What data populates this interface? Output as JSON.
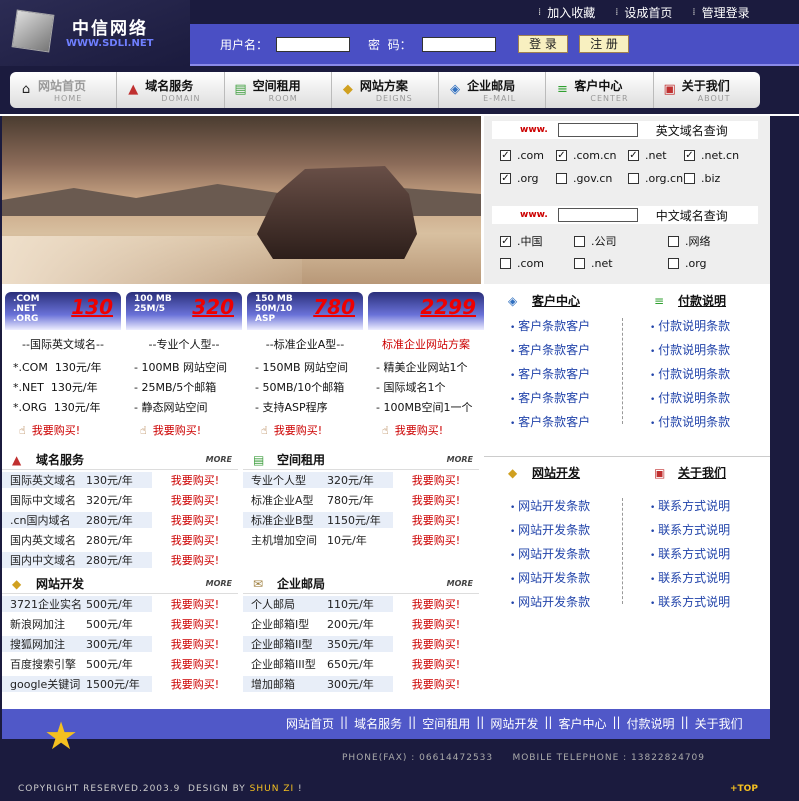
{
  "brand": {
    "name": "中信网络",
    "url": "WWW.SDLI.NET"
  },
  "topbar": [
    "加入收藏",
    "设成首页",
    "管理登录"
  ],
  "login": {
    "user_label": "用户名：",
    "pass_label": "密  码：",
    "login_btn": "登 录",
    "register_btn": "注 册"
  },
  "nav": [
    {
      "cn": "网站首页",
      "en": "HOME",
      "icon": "home-icon"
    },
    {
      "cn": "域名服务",
      "en": "DOMAIN",
      "icon": "domain-icon"
    },
    {
      "cn": "空间租用",
      "en": "ROOM",
      "icon": "room-icon"
    },
    {
      "cn": "网站方案",
      "en": "DEIGNS",
      "icon": "design-icon"
    },
    {
      "cn": "企业邮局",
      "en": "E-MAIL",
      "icon": "email-icon"
    },
    {
      "cn": "客户中心",
      "en": "CENTER",
      "icon": "center-icon"
    },
    {
      "cn": "关于我们",
      "en": "ABOUT",
      "icon": "about-icon"
    }
  ],
  "query_en": {
    "stars": "www.",
    "title": "英文域名查询",
    "row1": [
      {
        "label": ".com",
        "checked": true
      },
      {
        "label": ".com.cn",
        "checked": true
      },
      {
        "label": ".net",
        "checked": true
      },
      {
        "label": ".net.cn",
        "checked": true
      }
    ],
    "row2": [
      {
        "label": ".org",
        "checked": true
      },
      {
        "label": ".gov.cn",
        "checked": false
      },
      {
        "label": ".org.cn",
        "checked": false
      },
      {
        "label": ".biz",
        "checked": false
      }
    ]
  },
  "query_cn": {
    "stars": "www.",
    "title": "中文域名查询",
    "row1": [
      {
        "label": ".中国",
        "checked": true
      },
      {
        "label": ".公司",
        "checked": false
      },
      {
        "label": ".网络",
        "checked": false
      }
    ],
    "row2": [
      {
        "label": ".com",
        "checked": false
      },
      {
        "label": ".net",
        "checked": false
      },
      {
        "label": ".org",
        "checked": false
      }
    ]
  },
  "cards": [
    {
      "small": [
        ".COM",
        ".NET",
        ".ORG"
      ],
      "price": "130",
      "title": "--国际英文域名--",
      "lines": [
        "*.COM  130元/年",
        "*.NET  130元/年",
        "*.ORG  130元/年"
      ],
      "buy": "我要购买!"
    },
    {
      "small": [
        "100 MB",
        "25M/5"
      ],
      "price": "320",
      "title": "--专业个人型--",
      "lines": [
        "- 100MB 网站空间",
        "- 25MB/5个邮箱",
        "- 静态网站空间"
      ],
      "buy": "我要购买!"
    },
    {
      "small": [
        "150 MB",
        "50M/10",
        "ASP"
      ],
      "price": "780",
      "title": "--标准企业A型--",
      "lines": [
        "- 150MB 网站空间",
        "- 50MB/10个邮箱",
        "- 支持ASP程序"
      ],
      "buy": "我要购买!"
    },
    {
      "small": [],
      "price": "2299",
      "title": "标准企业网站方案",
      "lines": [
        "- 精美企业网站1个",
        "- 国际域名1个",
        "- 100MB空间1一个"
      ],
      "buy": "我要购买!"
    }
  ],
  "sections": {
    "domain": {
      "title": "域名服务",
      "more": "MORE",
      "rows": [
        [
          "国际英文域名",
          "130元/年"
        ],
        [
          "国际中文域名",
          "320元/年"
        ],
        [
          ".cn国内域名",
          "280元/年"
        ],
        [
          "国内英文域名",
          "280元/年"
        ],
        [
          "国内中文域名",
          "280元/年"
        ]
      ],
      "buy": "我要购买!"
    },
    "room": {
      "title": "空间租用",
      "more": "MORE",
      "rows": [
        [
          "专业个人型",
          "320元/年"
        ],
        [
          "标准企业A型",
          "780元/年"
        ],
        [
          "标准企业B型",
          "1150元/年"
        ],
        [
          "主机增加空间",
          "10元/年"
        ]
      ],
      "buy": "我要购买!"
    },
    "web": {
      "title": "网站开发",
      "more": "MORE",
      "rows": [
        [
          "3721企业实名",
          "500元/年"
        ],
        [
          "新浪网加注",
          "500元/年"
        ],
        [
          "搜狐网加注",
          "300元/年"
        ],
        [
          "百度搜索引擎",
          "500元/年"
        ],
        [
          "google关键词",
          "1500元/年"
        ]
      ],
      "buy": "我要购买!"
    },
    "mail": {
      "title": "企业邮局",
      "more": "MORE",
      "rows": [
        [
          "个人邮局",
          "110元/年"
        ],
        [
          "企业邮箱I型",
          "200元/年"
        ],
        [
          "企业邮箱II型",
          "350元/年"
        ],
        [
          "企业邮箱III型",
          "650元/年"
        ],
        [
          "增加邮箱",
          "300元/年"
        ]
      ],
      "buy": "我要购买!"
    }
  },
  "right": {
    "center": {
      "title": "客户中心",
      "items": [
        "客户条款客户",
        "客户条款客户",
        "客户条款客户",
        "客户条款客户",
        "客户条款客户"
      ]
    },
    "pay": {
      "title": "付款说明",
      "items": [
        "付款说明条款",
        "付款说明条款",
        "付款说明条款",
        "付款说明条款",
        "付款说明条款"
      ]
    },
    "dev": {
      "title": "网站开发",
      "items": [
        "网站开发条款",
        "网站开发条款",
        "网站开发条款",
        "网站开发条款",
        "网站开发条款"
      ]
    },
    "about": {
      "title": "关于我们",
      "items": [
        "联系方式说明",
        "联系方式说明",
        "联系方式说明",
        "联系方式说明",
        "联系方式说明"
      ]
    }
  },
  "footer": {
    "links": [
      "网站首页",
      "域名服务",
      "空间租用",
      "网站开发",
      "客户中心",
      "付款说明",
      "关于我们"
    ],
    "phone": "PHONE(FAX) : 06614472533     MOBILE TELEPHONE : 13822824709",
    "copyright": "COPYRIGHT RESERVED.2003.9  DESIGN BY ",
    "designer": "SHUN ZI",
    "copyright_end": " !",
    "top": "+TOP"
  }
}
